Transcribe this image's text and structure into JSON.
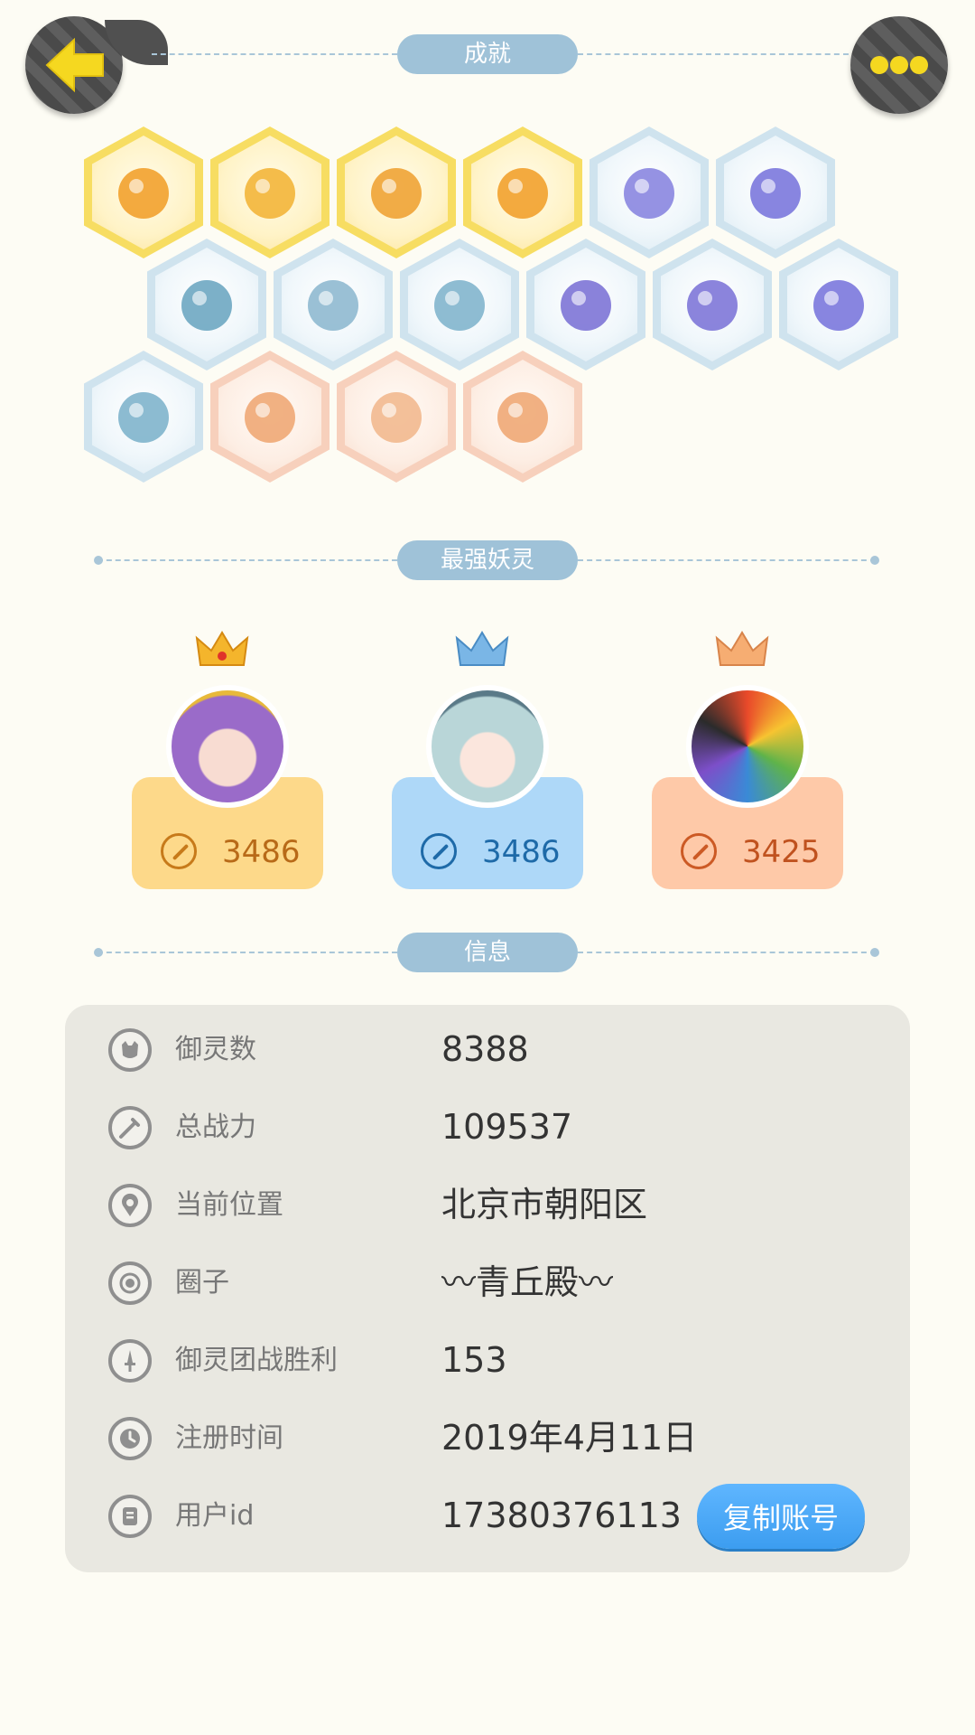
{
  "header": {
    "back_icon": "back-arrow-icon",
    "more_icon": "more-dots-icon",
    "achievements_title": "成就"
  },
  "achievements": [
    {
      "tier": "gold",
      "icon": "fox-face-icon",
      "color": "#f2a12e"
    },
    {
      "tier": "gold",
      "icon": "gold-orb-icon",
      "color": "#f3b53a"
    },
    {
      "tier": "gold",
      "icon": "yin-yang-swirl-icon",
      "color": "#f0a335"
    },
    {
      "tier": "gold",
      "icon": "fox-spirit-icon",
      "color": "#f2a12e"
    },
    {
      "tier": "blue",
      "icon": "sneaker-icon",
      "color": "#8a86e0"
    },
    {
      "tier": "blue",
      "icon": "portal-ring-icon",
      "color": "#7b78dd"
    },
    {
      "tier": "blue",
      "icon": "moon-planet-icon",
      "color": "#6ea7c2"
    },
    {
      "tier": "blue",
      "icon": "crystal-icon",
      "color": "#8fb9d0"
    },
    {
      "tier": "blue",
      "icon": "spirit-figure-icon",
      "color": "#82b5cd"
    },
    {
      "tier": "blue",
      "icon": "yin-yang-card-icon",
      "color": "#7d74d6"
    },
    {
      "tier": "blue",
      "icon": "koi-fish-icon",
      "color": "#7e77d8"
    },
    {
      "tier": "blue",
      "icon": "scroll-portal-icon",
      "color": "#7b78dd"
    },
    {
      "tier": "blue",
      "icon": "horned-spirit-icon",
      "color": "#7fb4cc"
    },
    {
      "tier": "peach",
      "icon": "stroller-cat-icon",
      "color": "#f0a875"
    },
    {
      "tier": "peach",
      "icon": "cat-pair-icon",
      "color": "#f2b98f"
    },
    {
      "tier": "peach",
      "icon": "fox-book-icon",
      "color": "#f0a875"
    }
  ],
  "strongest": {
    "title": "最强妖灵",
    "spirits": [
      {
        "crown_icon": "gold-crown-icon",
        "avatar_icon": "purple-hair-spirit-avatar",
        "power_icon": "sword-icon",
        "power": "3486",
        "color": "#fdd98a"
      },
      {
        "crown_icon": "blue-crown-icon",
        "avatar_icon": "silver-hair-spirit-avatar",
        "power_icon": "sword-icon",
        "power": "3486",
        "color": "#aed8f8"
      },
      {
        "crown_icon": "bronze-crown-icon",
        "avatar_icon": "crystal-dragon-spirit-avatar",
        "power_icon": "sword-icon",
        "power": "3425",
        "color": "#fec9a8"
      }
    ]
  },
  "info": {
    "title": "信息",
    "rows": [
      {
        "icon": "spirit-count-icon",
        "label": "御灵数",
        "value": "8388"
      },
      {
        "icon": "sword-icon",
        "label": "总战力",
        "value": "109537"
      },
      {
        "icon": "location-pin-icon",
        "label": "当前位置",
        "value": "北京市朝阳区"
      },
      {
        "icon": "circle-target-icon",
        "label": "圈子",
        "value": "〰青丘殿〰"
      },
      {
        "icon": "dagger-icon",
        "label": "御灵团战胜利",
        "value": "153"
      },
      {
        "icon": "clock-icon",
        "label": "注册时间",
        "value": "2019年4月11日"
      },
      {
        "icon": "id-card-icon",
        "label": "用户id",
        "value": "17380376113"
      }
    ],
    "copy_button": "复制账号"
  },
  "colors": {
    "background": "#fdfcf4",
    "section_pill": "#9fc2d8",
    "panel": "#e9e8e1",
    "copy_button": "#3c9df0",
    "back_arrow": "#f5d820"
  }
}
